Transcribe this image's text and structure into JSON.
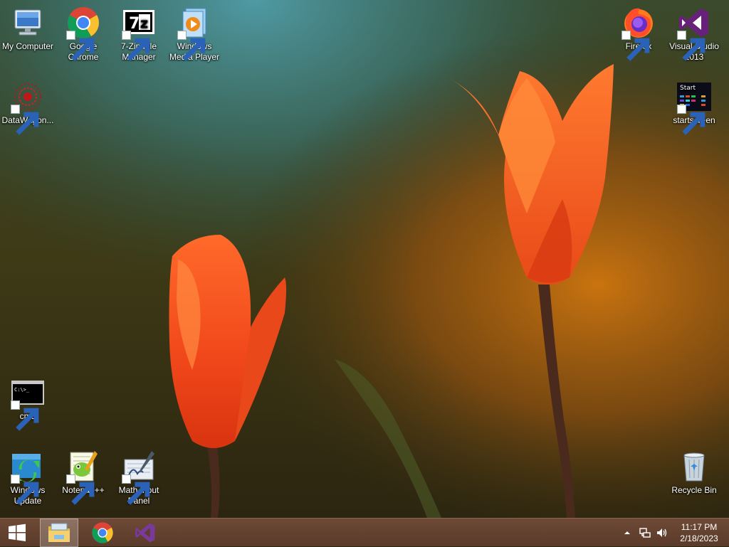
{
  "desktop": {
    "icons": [
      {
        "label": "My Computer"
      },
      {
        "label": "Google Chrome"
      },
      {
        "label": "7-Zip File Manager"
      },
      {
        "label": "Windows Media Player"
      },
      {
        "label": "Firefox"
      },
      {
        "label": "Visual Studio 2013"
      },
      {
        "label": "DataWagon..."
      },
      {
        "label": "startscreen",
        "tile_text": "Start"
      },
      {
        "label": "cmd",
        "console_text": "C:\\>_"
      },
      {
        "label": "Windows Update"
      },
      {
        "label": "Notepad++"
      },
      {
        "label": "Math Input Panel"
      },
      {
        "label": "Recycle Bin"
      }
    ]
  },
  "taskbar": {
    "pinned": [
      "windows-start",
      "file-explorer",
      "google-chrome",
      "visual-studio"
    ],
    "tray_icons": [
      "show-hidden-icons",
      "network-icon",
      "volume-icon"
    ],
    "clock": {
      "time": "11:17 PM",
      "date": "2/18/2023"
    }
  },
  "colors": {
    "taskbar": "#5e3e2c",
    "tulip": "#ff4a1a",
    "accent_vs": "#68217a"
  }
}
